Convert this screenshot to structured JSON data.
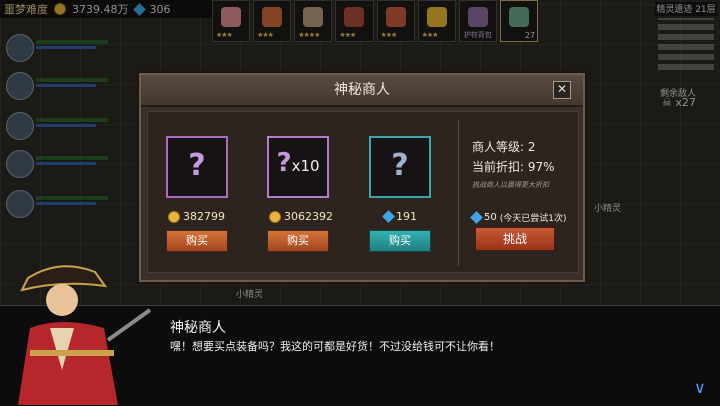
{
  "top": {
    "difficulty": "噩梦难度",
    "gold": "3739.48万",
    "gems": "306"
  },
  "items": [
    {
      "icon": "pig-icon",
      "stars": "★★★",
      "color": "#d98a8f"
    },
    {
      "icon": "quill-icon",
      "stars": "★★★",
      "color": "#c96b3a"
    },
    {
      "icon": "box-icon",
      "stars": "★★★★",
      "color": "#b49a7a"
    },
    {
      "icon": "belt-icon",
      "stars": "★★★",
      "color": "#a84b3a"
    },
    {
      "icon": "potion-icon",
      "stars": "★★★",
      "color": "#c45a3a"
    },
    {
      "icon": "feather-icon",
      "stars": "★★★",
      "color": "#e5b52f"
    },
    {
      "icon": "bag-icon",
      "label": "护符背包",
      "color": "#8a6a9a"
    },
    {
      "icon": "creature-icon",
      "count": "27",
      "color": "#6aa38a"
    }
  ],
  "minimap": {
    "title": "精灵遗迹 21层"
  },
  "enemies": {
    "label": "剩余敌人",
    "count": "x27"
  },
  "shop": {
    "title": "神秘商人",
    "slots": [
      {
        "mystery": "?",
        "price": "382799",
        "currency": "gold",
        "buy": "购买",
        "border": "#a96ac2"
      },
      {
        "mystery": "?",
        "qty": "x10",
        "price": "3062392",
        "currency": "gold",
        "buy": "购买",
        "border": "#b37ad0"
      },
      {
        "mystery": "?",
        "price": "191",
        "currency": "gem",
        "buy": "购买",
        "border": "#38a8a8"
      }
    ],
    "level_label": "商人等级:",
    "level": "2",
    "discount_label": "当前折扣:",
    "discount": "97%",
    "tip": "挑战商人以赢得更大折扣",
    "challenge_cost": "50",
    "challenge_note": "(今天已尝试1次)",
    "challenge_label": "挑战"
  },
  "sprite_labels": [
    "小精灵",
    "小精灵"
  ],
  "dialogue": {
    "speaker": "神秘商人",
    "text": "嘿！想要买点装备吗？我这的可都是好货！不过没给钱可不让你看！",
    "next_glyph": "∨"
  },
  "colors": {
    "gold": "#e8b53a",
    "gem": "#3fa6ea",
    "buy_orange": "#c66531",
    "buy_teal": "#2a9c9c",
    "challenge": "#b8452a"
  }
}
